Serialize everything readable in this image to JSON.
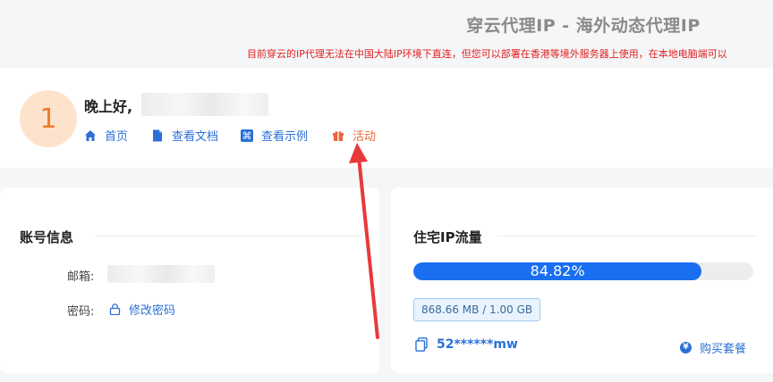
{
  "header": {
    "title": "穿云代理IP - 海外动态代理IP",
    "notice": "目前穿云的IP代理无法在中国大陆IP环境下直连，但您可以部署在香港等境外服务器上使用，在本地电脑端可以"
  },
  "user": {
    "avatar_text": "1",
    "greeting": "晚上好,"
  },
  "nav": {
    "home": "首页",
    "docs": "查看文档",
    "examples": "查看示例",
    "activity": "活动"
  },
  "account": {
    "title": "账号信息",
    "email_label": "邮箱:",
    "password_label": "密码:",
    "change_password": "修改密码"
  },
  "traffic": {
    "title": "住宅IP流量",
    "percent_text": "84.82%",
    "progress_value": 84.82,
    "usage": "868.66 MB / 1.00 GB",
    "account_id": "52******mw",
    "buy": "购买套餐"
  },
  "colors": {
    "accent": "#1a6ff0",
    "link": "#2b6fd6",
    "activity": "#e8663a",
    "notice": "#e02020",
    "arrow": "#e8393a"
  }
}
